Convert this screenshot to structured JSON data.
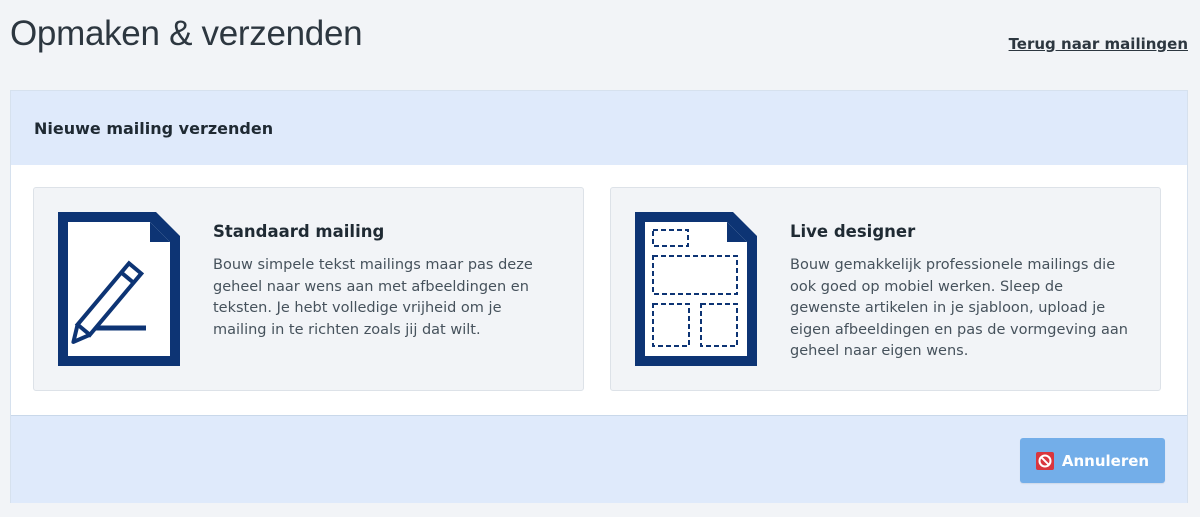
{
  "page": {
    "title": "Opmaken & verzenden",
    "back_link": "Terug naar mailingen"
  },
  "panel": {
    "header": "Nieuwe mailing verzenden",
    "options": [
      {
        "title": "Standaard mailing",
        "description": "Bouw simpele tekst mailings maar pas deze geheel naar wens aan met afbeeldingen en teksten. Je hebt volledige vrijheid om je mailing in te richten zoals jij dat wilt.",
        "icon": "pencil-document-icon"
      },
      {
        "title": "Live designer",
        "description": "Bouw gemakkelijk professionele mailings die ook goed op mobiel werken. Sleep de gewenste artikelen in je sjabloon, upload je eigen afbeeldingen en pas de vormgeving aan geheel naar eigen wens.",
        "icon": "layout-document-icon"
      }
    ],
    "cancel_label": "Annuleren"
  },
  "colors": {
    "brand_navy": "#0d3474",
    "header_bg": "#dfeafb",
    "button_bg": "#73aee9",
    "cancel_icon": "#d9363e"
  }
}
